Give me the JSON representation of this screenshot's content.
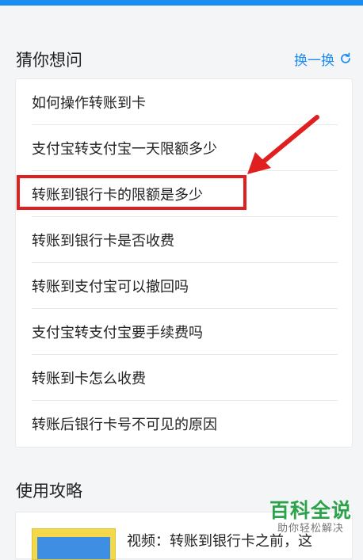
{
  "section1": {
    "title": "猜你想问",
    "refresh_label": "换一换",
    "items": [
      "如何操作转账到卡",
      "支付宝转支付宝一天限额多少",
      "转账到银行卡的限额是多少",
      "转账到银行卡是否收费",
      "转账到支付宝可以撤回吗",
      "支付宝转支付宝要手续费吗",
      "转账到卡怎么收费",
      "转账后银行卡号不可见的原因"
    ]
  },
  "section2": {
    "title": "使用攻略",
    "video_title": "视频：转账到银行卡之前，这"
  },
  "watermark": {
    "main": "百科全说",
    "sub": "助你轻松解决"
  },
  "colors": {
    "accent": "#1a8cf2",
    "highlight": "#e02020",
    "watermark": "#2aa34a"
  }
}
